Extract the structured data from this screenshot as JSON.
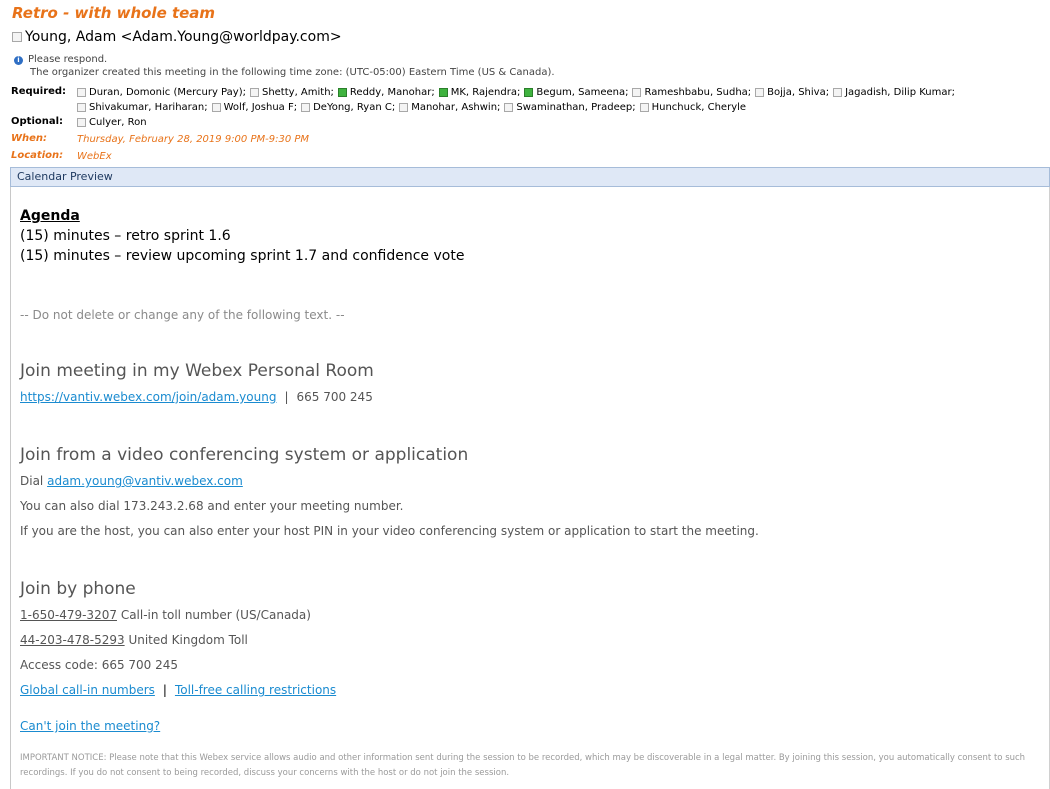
{
  "header": {
    "subject": "Retro - with whole team",
    "from": "Young, Adam <Adam.Young@worldpay.com>",
    "info_line1": "Please respond.",
    "info_line2": "The organizer created this meeting in the following time zone: (UTC-05:00) Eastern Time (US & Canada).",
    "required_label": "Required:",
    "required": [
      {
        "name": "Duran, Domonic (Mercury Pay);",
        "accepted": false
      },
      {
        "name": "Shetty, Amith;",
        "accepted": false
      },
      {
        "name": "Reddy, Manohar;",
        "accepted": true
      },
      {
        "name": "MK, Rajendra;",
        "accepted": true
      },
      {
        "name": "Begum, Sameena;",
        "accepted": true
      },
      {
        "name": "Rameshbabu, Sudha;",
        "accepted": false
      },
      {
        "name": "Bojja, Shiva;",
        "accepted": false
      },
      {
        "name": "Jagadish, Dilip Kumar;",
        "accepted": false
      },
      {
        "name": "Shivakumar, Hariharan;",
        "accepted": false
      },
      {
        "name": "Wolf, Joshua F;",
        "accepted": false
      },
      {
        "name": "DeYong, Ryan C;",
        "accepted": false
      },
      {
        "name": "Manohar, Ashwin;",
        "accepted": false
      },
      {
        "name": "Swaminathan, Pradeep;",
        "accepted": false
      },
      {
        "name": "Hunchuck, Cheryle",
        "accepted": false
      }
    ],
    "optional_label": "Optional:",
    "optional": [
      {
        "name": "Culyer, Ron",
        "accepted": false
      }
    ],
    "when_label": "When:",
    "when": "Thursday, February 28, 2019 9:00 PM-9:30 PM",
    "location_label": "Location:",
    "location": "WebEx"
  },
  "preview_bar": "Calendar Preview",
  "body": {
    "agenda_title": "Agenda",
    "agenda_items": [
      "(15) minutes – retro sprint 1.6",
      "(15) minutes – review upcoming sprint 1.7 and confidence vote"
    ],
    "do_not_delete": "-- Do not delete or change any of the following text. --",
    "personal_room": {
      "heading": "Join meeting in my Webex Personal Room",
      "link": "https://vantiv.webex.com/join/adam.young",
      "separator": "|",
      "meeting_number": "665 700 245"
    },
    "video": {
      "heading": "Join from a video conferencing system or application",
      "dial_prefix": "Dial",
      "dial_link": "adam.young@vantiv.webex.com",
      "line2": "You can also dial 173.243.2.68 and enter your meeting number.",
      "line3": "If you are the host, you can also enter your host PIN in your video conferencing system or application to start the meeting."
    },
    "phone": {
      "heading": "Join by phone",
      "number1": "1-650-479-3207",
      "number1_desc": "Call-in toll number (US/Canada)",
      "number2": "44-203-478-5293",
      "number2_desc": "United Kingdom Toll",
      "access_code": "Access code: 665 700 245",
      "global_link": "Global call-in numbers",
      "separator": "|",
      "tollfree_link": "Toll-free calling restrictions"
    },
    "cant_join": "Can't join the meeting?",
    "notice": "IMPORTANT NOTICE: Please note that this Webex service allows audio and other information sent during the session to be recorded, which may be discoverable in a legal matter. By joining this session, you automatically consent to such recordings. If you do not consent to being recorded, discuss your concerns with the host or do not join the session."
  }
}
